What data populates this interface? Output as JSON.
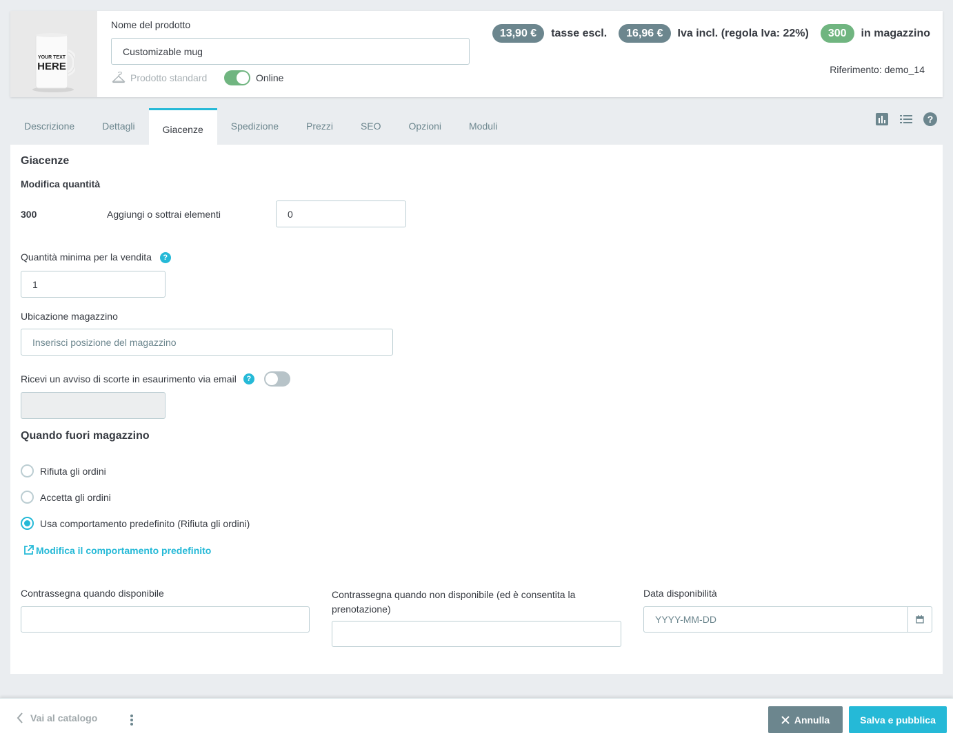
{
  "header": {
    "mug_text_line1": "YOUR TEXT",
    "mug_text_line2": "HERE",
    "name_label": "Nome del prodotto",
    "name_value": "Customizable mug",
    "type_label": "Prodotto standard",
    "status_label": "Online",
    "status_on": true,
    "price_excl": "13,90 €",
    "price_excl_label": "tasse escl.",
    "price_incl": "16,96 €",
    "price_incl_label": "Iva incl. (regola Iva: 22%)",
    "stock": "300",
    "stock_label": "in magazzino",
    "reference": "Riferimento: demo_14"
  },
  "tabs": [
    {
      "label": "Descrizione"
    },
    {
      "label": "Dettagli"
    },
    {
      "label": "Giacenze",
      "active": true
    },
    {
      "label": "Spedizione"
    },
    {
      "label": "Prezzi"
    },
    {
      "label": "SEO"
    },
    {
      "label": "Opzioni"
    },
    {
      "label": "Moduli"
    }
  ],
  "tab_icons": [
    "stats-icon",
    "list-icon",
    "help-icon"
  ],
  "stock": {
    "title": "Giacenze",
    "subtitle": "Modifica quantità",
    "quantity": "300",
    "add_label": "Aggiungi o sottrai elementi",
    "add_value": "0",
    "min_qty_label": "Quantità minima per la vendita",
    "min_qty_value": "1",
    "location_label": "Ubicazione magazzino",
    "location_placeholder": "Inserisci posizione del magazzino",
    "low_stock_label": "Ricevi un avviso di scorte in esaurimento via email",
    "low_stock_on": false,
    "help_glyph": "?"
  },
  "out_of_stock": {
    "title": "Quando fuori magazzino",
    "options": [
      {
        "label": "Rifiuta gli ordini",
        "checked": false
      },
      {
        "label": "Accetta gli ordini",
        "checked": false
      },
      {
        "label": "Usa comportamento predefinito (Rifiuta gli ordini)",
        "checked": true
      }
    ],
    "edit_link": "Modifica il comportamento predefinito"
  },
  "availability": {
    "available_label": "Contrassegna quando disponibile",
    "unavailable_label": "Contrassegna quando non disponibile (ed è consentita la prenotazione)",
    "date_label": "Data disponibilità",
    "date_placeholder": "YYYY-MM-DD"
  },
  "footer": {
    "back_label": "Vai al catalogo",
    "cancel_label": "Annulla",
    "save_label": "Salva e pubblica"
  },
  "colors": {
    "accent": "#25b9d7",
    "success": "#70b580",
    "secondary": "#6c868e"
  }
}
